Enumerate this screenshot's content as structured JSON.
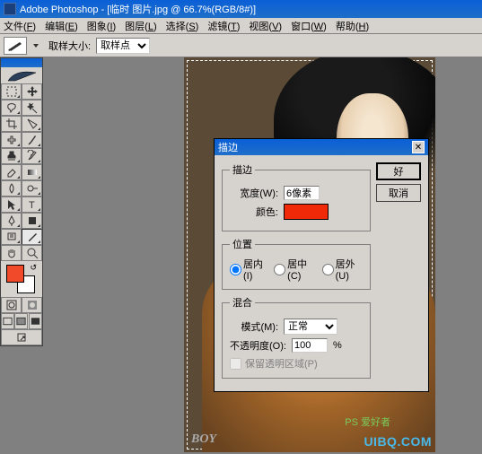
{
  "app": {
    "title": "Adobe Photoshop - [临时 图片.jpg @ 66.7%(RGB/8#)]"
  },
  "menu": {
    "items": [
      {
        "label": "文件",
        "letter": "F"
      },
      {
        "label": "编辑",
        "letter": "E"
      },
      {
        "label": "图象",
        "letter": "I"
      },
      {
        "label": "图层",
        "letter": "L"
      },
      {
        "label": "选择",
        "letter": "S"
      },
      {
        "label": "滤镜",
        "letter": "T"
      },
      {
        "label": "视图",
        "letter": "V"
      },
      {
        "label": "窗口",
        "letter": "W"
      },
      {
        "label": "帮助",
        "letter": "H"
      }
    ]
  },
  "options": {
    "label": "取样大小:",
    "select_value": "取样点"
  },
  "swatches": {
    "fg": "#f04a2a",
    "bg": "#ffffff"
  },
  "dialog": {
    "title": "描边",
    "ok": "好",
    "cancel": "取消",
    "groups": {
      "stroke": {
        "legend": "描边",
        "width_label": "宽度(W):",
        "width_value": "6像素",
        "color_label": "颜色:",
        "color_value": "#f02a08"
      },
      "position": {
        "legend": "位置",
        "options": [
          {
            "label": "居内(I)",
            "checked": true
          },
          {
            "label": "居中(C)",
            "checked": false
          },
          {
            "label": "居外(U)",
            "checked": false
          }
        ]
      },
      "blend": {
        "legend": "混合",
        "mode_label": "模式(M):",
        "mode_value": "正常",
        "opacity_label": "不透明度(O):",
        "opacity_value": "100",
        "opacity_suffix": "%",
        "preserve_label": "保留透明区域(P)"
      }
    }
  },
  "canvas": {
    "wm_boy": "BOY",
    "wm_ps": "PS 爱好者",
    "wm_url": "UIBQ.COM"
  }
}
